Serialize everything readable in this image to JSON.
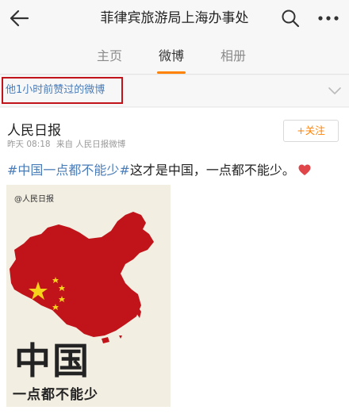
{
  "header": {
    "title": "菲律宾旅游局上海办事处"
  },
  "tabs": [
    {
      "label": "主页",
      "active": false
    },
    {
      "label": "微博",
      "active": true
    },
    {
      "label": "相册",
      "active": false
    }
  ],
  "liked_banner": {
    "text": "他1小时前赞过的微博"
  },
  "post": {
    "author": "人民日报",
    "time": "昨天 08:18",
    "source": "来自 人民日报微博",
    "follow_label": "+关注",
    "hashtag": "#中国一点都不能少#",
    "text": "这才是中国，一点都不能少。",
    "image": {
      "logo": "@人民日报",
      "big_text": "中国",
      "sub_text": "一点都不能少"
    }
  },
  "colors": {
    "accent": "#ff8200",
    "link": "#4a7cb8",
    "highlight_box": "#c0141a",
    "map_red": "#c0141a",
    "star_yellow": "#f7d21a"
  },
  "icons": {
    "back": "arrow-left",
    "search": "magnifier",
    "more": "three-dots",
    "chevron": "chevron-down",
    "heart": "heart"
  }
}
